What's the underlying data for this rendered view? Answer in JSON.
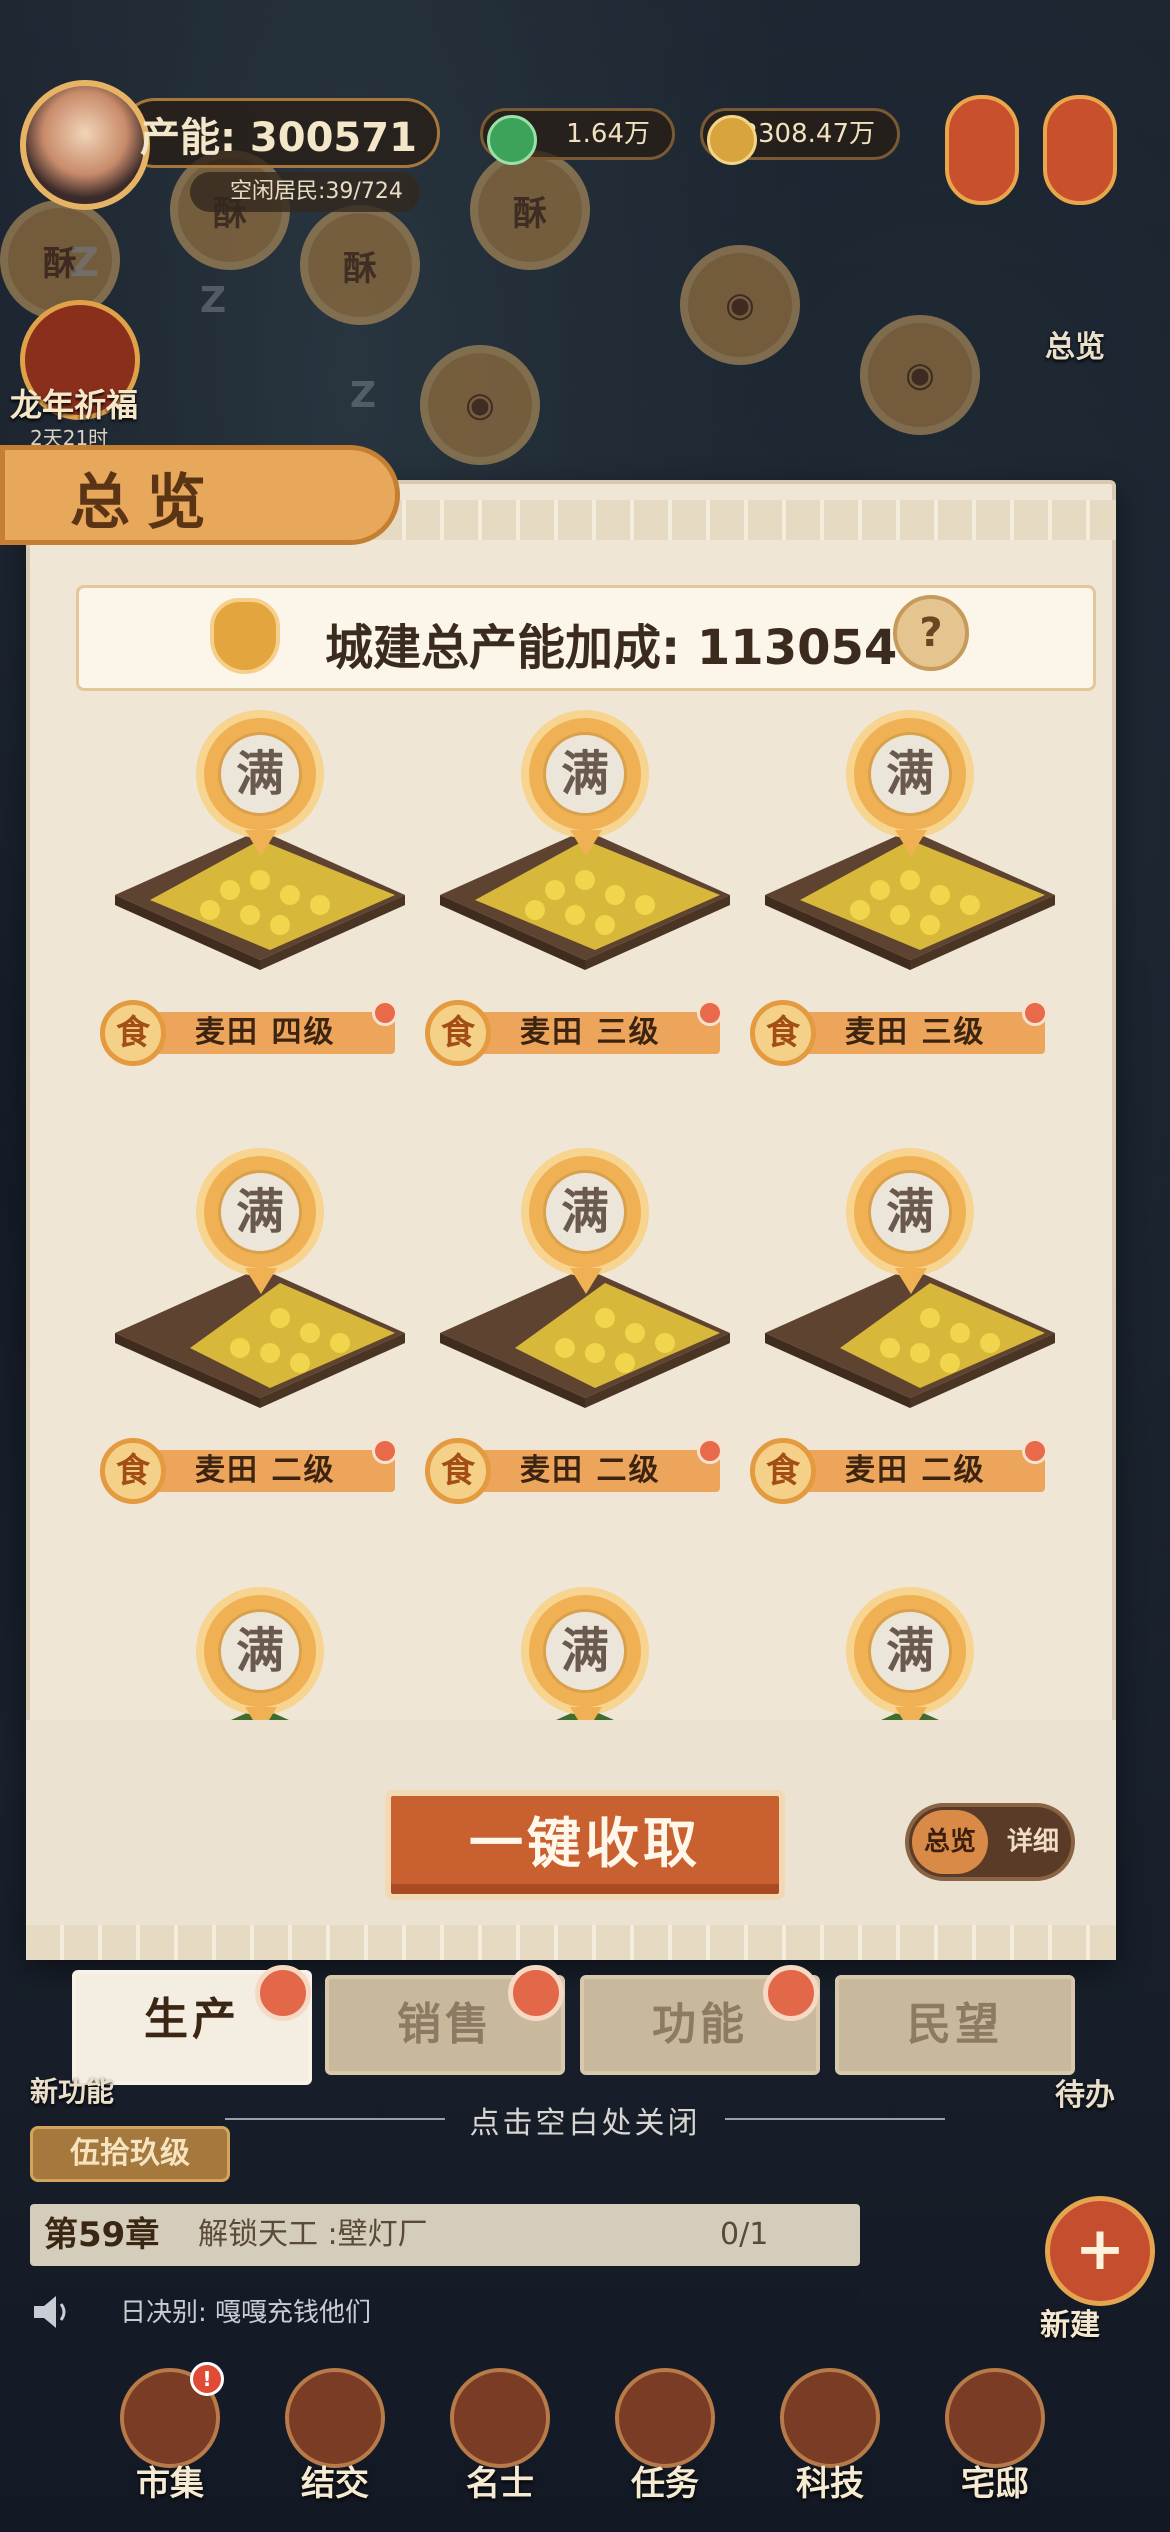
{
  "hud": {
    "power_label": "产能: 300571",
    "residents": "空闲居民:39/724",
    "currency_1": "1.64万",
    "currency_2": "2308.47万",
    "festival_label": "龙年祈福",
    "festival_time": "2天21时",
    "overview_label": "总览"
  },
  "panel": {
    "title": "总览",
    "bonus_text": "城建总产能加成: 113054",
    "help_label": "?",
    "full_label": "满",
    "food_label": "食",
    "cells": [
      {
        "name": "麦田 四级"
      },
      {
        "name": "麦田 三级"
      },
      {
        "name": "麦田 三级"
      },
      {
        "name": "麦田 二级"
      },
      {
        "name": "麦田 二级"
      },
      {
        "name": "麦田 二级"
      }
    ],
    "collect_button": "一键收取",
    "toggle_on": "总览",
    "toggle_off": "详细",
    "tabs": [
      "生产",
      "销售",
      "功能",
      "民望"
    ]
  },
  "close_hint": "点击空白处关闭",
  "side": {
    "new_function": "新功能",
    "todo": "待办",
    "new_build": "新建"
  },
  "quest": {
    "level_tag": "伍拾玖级",
    "chapter": "第59章",
    "text": "解锁天工 :壁灯厂",
    "progress": "0/1"
  },
  "chat": {
    "text": "日决别: 嘎嘎充钱他们"
  },
  "nav": [
    "市集",
    "结交",
    "名士",
    "任务",
    "科技",
    "宅邸"
  ],
  "colors": {
    "accent": "#c8612f",
    "panel_bg": "#efe6d6",
    "label_bar": "#eda55c",
    "badge": "#f0b154"
  }
}
